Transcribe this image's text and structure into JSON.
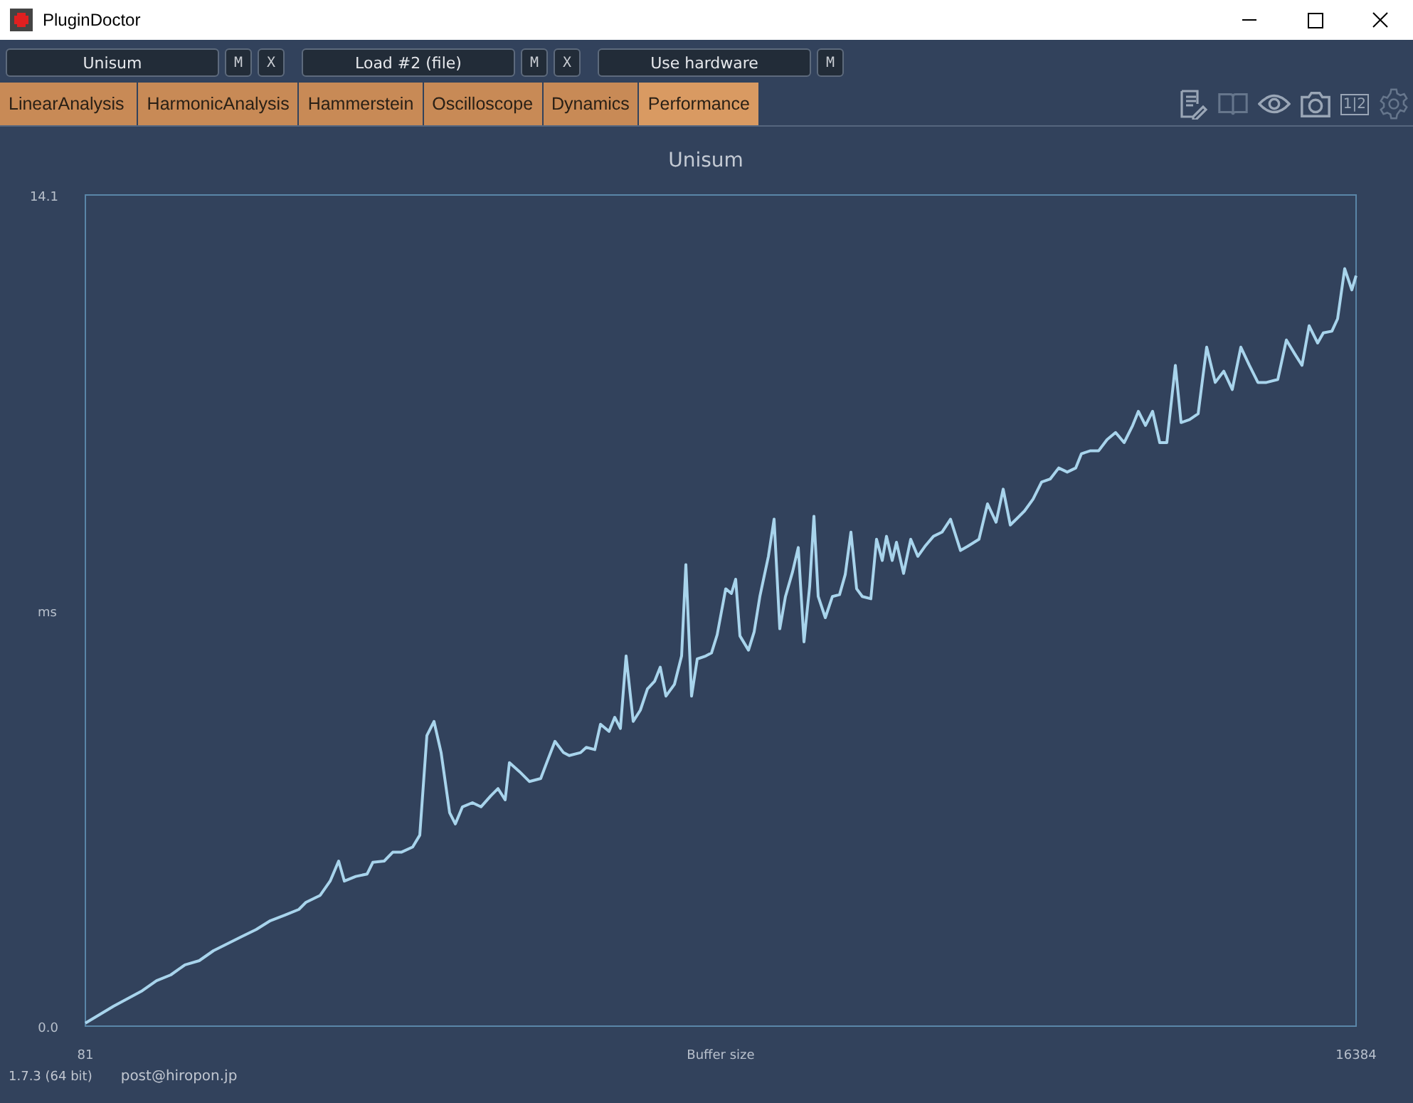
{
  "window": {
    "title": "PluginDoctor",
    "controls": [
      {
        "kind": "minimize"
      },
      {
        "kind": "maximize"
      },
      {
        "kind": "close"
      }
    ]
  },
  "slots": [
    {
      "name": "Unisum",
      "buttons": [
        "M",
        "X"
      ]
    },
    {
      "name": "Load #2 (file)",
      "buttons": [
        "M",
        "X"
      ]
    },
    {
      "name": "Use hardware",
      "buttons": [
        "M"
      ]
    }
  ],
  "tabs": [
    {
      "label": "LinearAnalysis",
      "selected": false
    },
    {
      "label": "HarmonicAnalysis",
      "selected": false
    },
    {
      "label": "Hammerstein",
      "selected": false
    },
    {
      "label": "Oscilloscope",
      "selected": false
    },
    {
      "label": "Dynamics",
      "selected": false
    },
    {
      "label": "Performance",
      "selected": true
    }
  ],
  "toolbar_icons": [
    {
      "kind": "notes"
    },
    {
      "kind": "book"
    },
    {
      "kind": "eye"
    },
    {
      "kind": "camera"
    },
    {
      "kind": "split",
      "text": "1|2"
    },
    {
      "kind": "settings"
    }
  ],
  "chart": {
    "chart_data": {
      "type": "line",
      "title": "Unisum",
      "xlabel": "Buffer size",
      "ylabel": "ms",
      "xlim": [
        81,
        16384
      ],
      "ylim": [
        0,
        14.1
      ],
      "xticks": [
        81,
        16384
      ],
      "yticks": [
        {
          "value": 0,
          "label": "0.0"
        },
        {
          "value": 14.1,
          "label": "14.1"
        }
      ],
      "x": [
        81,
        446,
        811,
        994,
        1176,
        1359,
        1541,
        1724,
        1907,
        2089,
        2272,
        2454,
        2637,
        2819,
        2911,
        3093,
        3221,
        3331,
        3404,
        3550,
        3696,
        3769,
        3915,
        4024,
        4134,
        4280,
        4371,
        4462,
        4554,
        4645,
        4755,
        4828,
        4919,
        5047,
        5157,
        5284,
        5375,
        5467,
        5521,
        5649,
        5777,
        5923,
        6014,
        6105,
        6215,
        6288,
        6434,
        6507,
        6617,
        6690,
        6799,
        6872,
        6945,
        7018,
        7110,
        7201,
        7292,
        7383,
        7456,
        7529,
        7639,
        7730,
        7785,
        7858,
        7931,
        8041,
        8114,
        8187,
        8296,
        8369,
        8424,
        8479,
        8588,
        8661,
        8734,
        8844,
        8917,
        8990,
        9063,
        9154,
        9227,
        9300,
        9373,
        9428,
        9483,
        9574,
        9665,
        9757,
        9830,
        9903,
        9976,
        10049,
        10158,
        10231,
        10304,
        10359,
        10432,
        10487,
        10578,
        10669,
        10761,
        10852,
        10962,
        11071,
        11181,
        11308,
        11400,
        11546,
        11655,
        11765,
        11856,
        11947,
        12039,
        12130,
        12240,
        12349,
        12459,
        12569,
        12678,
        12787,
        12860,
        12970,
        13079,
        13189,
        13298,
        13408,
        13517,
        13590,
        13682,
        13773,
        13864,
        13955,
        14065,
        14138,
        14248,
        14357,
        14467,
        14576,
        14686,
        14795,
        14905,
        15014,
        15124,
        15233,
        15379,
        15489,
        15599,
        15690,
        15781,
        15891,
        15964,
        16073,
        16146,
        16238,
        16329,
        16384
      ],
      "series": [
        {
          "color": "#a8d4ec",
          "values": [
            0.05,
            0.34,
            0.6,
            0.77,
            0.87,
            1.04,
            1.11,
            1.28,
            1.4,
            1.52,
            1.64,
            1.79,
            1.88,
            1.98,
            2.1,
            2.22,
            2.46,
            2.8,
            2.46,
            2.54,
            2.58,
            2.78,
            2.8,
            2.95,
            2.95,
            3.04,
            3.24,
            4.93,
            5.17,
            4.64,
            3.62,
            3.43,
            3.72,
            3.79,
            3.72,
            3.91,
            4.03,
            3.84,
            4.47,
            4.32,
            4.15,
            4.2,
            4.52,
            4.83,
            4.64,
            4.59,
            4.64,
            4.73,
            4.69,
            5.12,
            5.0,
            5.24,
            5.05,
            6.28,
            5.17,
            5.36,
            5.72,
            5.85,
            6.09,
            5.6,
            5.8,
            6.28,
            7.83,
            5.6,
            6.23,
            6.28,
            6.33,
            6.64,
            7.42,
            7.34,
            7.58,
            6.62,
            6.38,
            6.69,
            7.29,
            7.97,
            8.6,
            6.74,
            7.29,
            7.71,
            8.12,
            6.52,
            7.46,
            8.65,
            7.29,
            6.93,
            7.29,
            7.32,
            7.66,
            8.38,
            7.42,
            7.29,
            7.25,
            8.26,
            7.9,
            8.31,
            7.9,
            8.21,
            7.68,
            8.26,
            7.97,
            8.14,
            8.31,
            8.38,
            8.6,
            8.07,
            8.14,
            8.26,
            8.86,
            8.55,
            9.11,
            8.5,
            8.62,
            8.74,
            8.94,
            9.23,
            9.28,
            9.47,
            9.4,
            9.47,
            9.71,
            9.76,
            9.76,
            9.95,
            10.07,
            9.9,
            10.19,
            10.43,
            10.19,
            10.43,
            9.9,
            9.9,
            11.21,
            10.24,
            10.29,
            10.39,
            11.52,
            10.92,
            11.11,
            10.8,
            11.52,
            11.21,
            10.92,
            10.92,
            10.97,
            11.64,
            11.4,
            11.21,
            11.88,
            11.59,
            11.76,
            11.79,
            12.0,
            12.85,
            12.49,
            12.73
          ]
        }
      ]
    }
  },
  "footer": {
    "version": "1.7.3 (64 bit)",
    "email": "post@hiropon.jp"
  }
}
